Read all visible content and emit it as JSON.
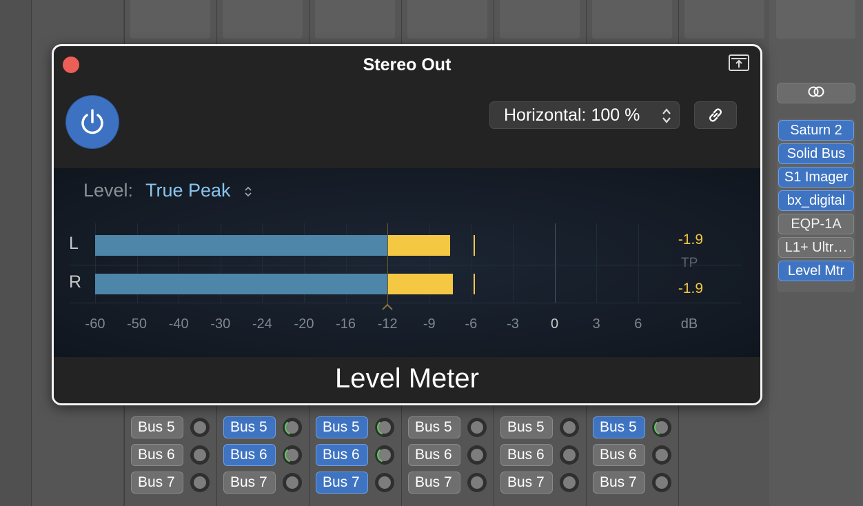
{
  "window": {
    "title": "Stereo Out",
    "plugin_name": "Level Meter",
    "view_selector": "Horizontal: 100 %",
    "power_on": true
  },
  "meter": {
    "level_label": "Level:",
    "level_mode": "True Peak",
    "channels": [
      {
        "name": "L",
        "blue_to_db": -12,
        "yellow_to_db": -7.5,
        "peak_hold_db": -5.8,
        "value": "-1.9"
      },
      {
        "name": "R",
        "blue_to_db": -12,
        "yellow_to_db": -7.3,
        "peak_hold_db": -5.8,
        "value": "-1.9"
      }
    ],
    "peak_type": "TP",
    "scale": [
      "-60",
      "-50",
      "-40",
      "-30",
      "-24",
      "-20",
      "-16",
      "-12",
      "-9",
      "-6",
      "-3",
      "0",
      "3",
      "6"
    ],
    "scale_unit": "dB",
    "target_marker_db": -12
  },
  "inserts": {
    "plugins": [
      {
        "label": "Saturn 2",
        "active": true
      },
      {
        "label": "Solid Bus",
        "active": true
      },
      {
        "label": "S1 Imager",
        "active": true
      },
      {
        "label": "bx_digital",
        "active": true
      },
      {
        "label": "EQP-1A",
        "active": false
      },
      {
        "label": "L1+ Ultr…",
        "active": false
      },
      {
        "label": "Level Mtr",
        "active": true
      }
    ]
  },
  "sends": {
    "rows": [
      "Bus 5",
      "Bus 6",
      "Bus 7"
    ],
    "columns": [
      {
        "active": [
          false,
          false,
          false
        ],
        "arc": [
          false,
          false,
          false
        ]
      },
      {
        "active": [
          true,
          true,
          false
        ],
        "arc": [
          true,
          true,
          false
        ]
      },
      {
        "active": [
          true,
          true,
          true
        ],
        "arc": [
          true,
          true,
          false
        ]
      },
      {
        "active": [
          false,
          false,
          false
        ],
        "arc": [
          false,
          false,
          false
        ]
      },
      {
        "active": [
          false,
          false,
          false
        ],
        "arc": [
          false,
          false,
          false
        ]
      },
      {
        "active": [
          true,
          false,
          false
        ],
        "arc": [
          true,
          false,
          false
        ]
      }
    ]
  },
  "colors": {
    "meter_blue": "#4d86a9",
    "meter_yellow": "#f4c843",
    "accent_blue": "#3d72c3",
    "close_red": "#ec5f57",
    "mode_text": "#8ac4ee"
  }
}
